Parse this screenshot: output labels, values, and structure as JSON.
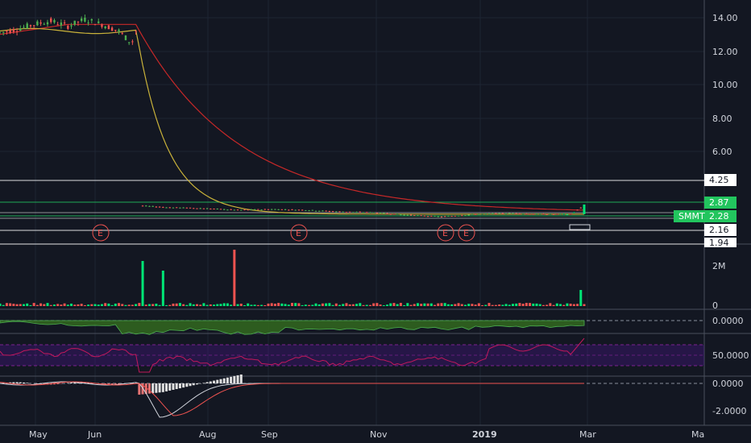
{
  "chart_data": {
    "type": "candlestick",
    "symbol": "SMMT",
    "last_price": "2.28",
    "price_axis": {
      "ticks": [
        "14.00",
        "12.00",
        "10.00",
        "8.00",
        "6.00",
        "4.25",
        "2.87",
        "2.28",
        "2.16",
        "1.94"
      ],
      "range": [
        1.0,
        15.0
      ]
    },
    "price_levels": [
      {
        "label": "4.25",
        "value": 4.25,
        "color": "#ffffff"
      },
      {
        "label": "2.87",
        "value": 2.87,
        "color": "#22c55e"
      },
      {
        "label": "2.28",
        "value": 2.28,
        "color": "#22c55e"
      },
      {
        "label": "2.16",
        "value": 2.16,
        "color": "#ffffff"
      },
      {
        "label": "1.94",
        "value": 1.94,
        "color": "#ffffff"
      }
    ],
    "time_axis": [
      "May",
      "Jun",
      "Aug",
      "Sep",
      "Nov",
      "2019",
      "Mar",
      "Ma"
    ],
    "earnings_markers": [
      "E",
      "E",
      "E",
      "E"
    ],
    "price_series": [
      {
        "t": 0,
        "v": 13.1
      },
      {
        "t": 5,
        "v": 13.3
      },
      {
        "t": 10,
        "v": 13.6
      },
      {
        "t": 15,
        "v": 13.8
      },
      {
        "t": 20,
        "v": 13.5
      },
      {
        "t": 25,
        "v": 13.9
      },
      {
        "t": 30,
        "v": 13.6
      },
      {
        "t": 35,
        "v": 13.2
      },
      {
        "t": 38,
        "v": 12.6
      },
      {
        "t": 40,
        "v": 13.2
      },
      {
        "t": 42,
        "v": 2.7
      },
      {
        "t": 50,
        "v": 2.6
      },
      {
        "t": 60,
        "v": 2.55
      },
      {
        "t": 70,
        "v": 2.45
      },
      {
        "t": 80,
        "v": 2.5
      },
      {
        "t": 90,
        "v": 2.45
      },
      {
        "t": 100,
        "v": 2.35
      },
      {
        "t": 110,
        "v": 2.3
      },
      {
        "t": 120,
        "v": 2.15
      },
      {
        "t": 130,
        "v": 2.05
      },
      {
        "t": 140,
        "v": 2.2
      },
      {
        "t": 150,
        "v": 2.25
      },
      {
        "t": 160,
        "v": 2.2
      },
      {
        "t": 168,
        "v": 2.2
      },
      {
        "t": 172,
        "v": 2.7
      }
    ],
    "volume_axis": {
      "ticks": [
        "2M",
        "0"
      ]
    },
    "indicator1_axis": {
      "ticks": [
        "0.0000"
      ]
    },
    "indicator2_axis": {
      "ticks": [
        "50.0000"
      ]
    },
    "indicator3_axis": {
      "ticks": [
        "0.0000",
        "-2.0000"
      ]
    },
    "colors": {
      "up": "#26a69a",
      "up_bright": "#00e676",
      "down": "#ef5350",
      "ma_fast": "#c9b23a",
      "ma_slow": "#c62828"
    }
  }
}
